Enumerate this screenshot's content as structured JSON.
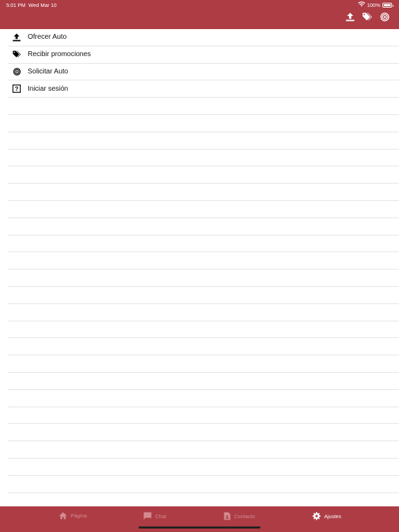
{
  "status_bar": {
    "time": "5:01 PM",
    "date": "Wed Mar 10",
    "battery": "100%",
    "wifi_icon": "wifi-icon",
    "battery_icon": "battery-icon"
  },
  "header": {
    "actions": [
      {
        "icon": "upload-icon"
      },
      {
        "icon": "tags-icon"
      },
      {
        "icon": "target-icon"
      }
    ]
  },
  "menu": {
    "items": [
      {
        "icon": "upload-icon",
        "label": "Ofrecer Auto"
      },
      {
        "icon": "tags-icon",
        "label": "Recibir promociones"
      },
      {
        "icon": "target-icon",
        "label": "Solicitar Auto"
      },
      {
        "icon": "question-box-icon",
        "label": "Iniciar sesión"
      }
    ],
    "empty_rows": 24
  },
  "tabbar": {
    "tabs": [
      {
        "icon": "home-icon",
        "label": "Página",
        "active": false
      },
      {
        "icon": "chat-icon",
        "label": "Chat",
        "active": false
      },
      {
        "icon": "contact-document-icon",
        "label": "Contacto",
        "active": false
      },
      {
        "icon": "gear-icon",
        "label": "Ajustes",
        "active": true
      }
    ]
  },
  "colors": {
    "brand": "#ad3c45",
    "tab_inactive": "#d58a90",
    "tab_active": "#ffffff",
    "divider": "#e4e4e4"
  }
}
